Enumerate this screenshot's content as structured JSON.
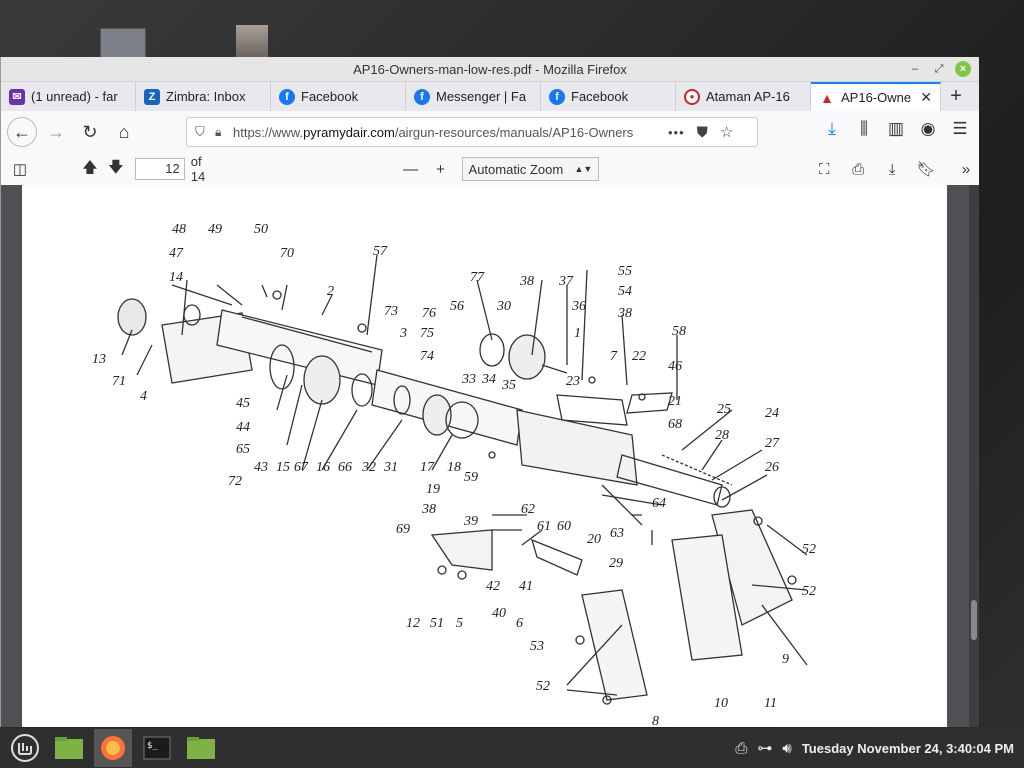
{
  "window": {
    "title": "AP16-Owners-man-low-res.pdf - Mozilla Firefox"
  },
  "tabs": [
    {
      "label": "(1 unread) - far",
      "icon": "mail-icon"
    },
    {
      "label": "Zimbra: Inbox",
      "icon": "zimbra-icon"
    },
    {
      "label": "Facebook",
      "icon": "facebook-icon"
    },
    {
      "label": "Messenger | Fa",
      "icon": "facebook-icon"
    },
    {
      "label": "Facebook",
      "icon": "facebook-icon"
    },
    {
      "label": "Ataman AP-16",
      "icon": "ataman-icon"
    },
    {
      "label": "AP16-Owne",
      "icon": "pdf-icon"
    }
  ],
  "urlbar": {
    "prefix": "https://www.",
    "domain": "pyramydair.com",
    "path": "/airgun-resources/manuals/AP16-Owners",
    "more": "•••"
  },
  "pdf": {
    "page_number": "12",
    "page_total": "of 14",
    "zoom": "Automatic Zoom"
  },
  "diagram": {
    "labels": [
      "48",
      "49",
      "50",
      "47",
      "70",
      "57",
      "14",
      "2",
      "77",
      "38",
      "37",
      "55",
      "54",
      "56",
      "30",
      "36",
      "38",
      "13",
      "73",
      "76",
      "1",
      "58",
      "71",
      "75",
      "3",
      "74",
      "7",
      "22",
      "46",
      "33",
      "34",
      "35",
      "23",
      "4",
      "45",
      "21",
      "44",
      "25",
      "24",
      "65",
      "68",
      "28",
      "72",
      "43",
      "15",
      "67",
      "16",
      "66",
      "32",
      "31",
      "17",
      "18",
      "27",
      "26",
      "19",
      "59",
      "38",
      "62",
      "64",
      "69",
      "39",
      "61",
      "60",
      "63",
      "20",
      "29",
      "42",
      "52",
      "41",
      "52",
      "12",
      "51",
      "5",
      "40",
      "6",
      "53",
      "52",
      "9",
      "10",
      "11",
      "8"
    ]
  },
  "taskbar": {
    "clock": "Tuesday November 24, 3:40:04 PM"
  },
  "colors": {
    "accent": "#0a84ff",
    "close": "#7cc64a"
  }
}
